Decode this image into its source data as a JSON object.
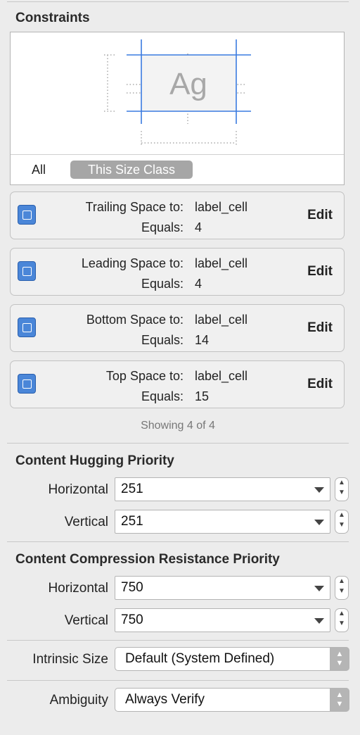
{
  "constraints": {
    "title": "Constraints",
    "preview_text": "Ag",
    "tabs": {
      "all": "All",
      "size_class": "This Size Class"
    },
    "rows": [
      {
        "label": "Trailing Space to:",
        "target": "label_cell",
        "equals_label": "Equals:",
        "value": "4",
        "edit": "Edit",
        "icon": "trailing-space-icon"
      },
      {
        "label": "Leading Space to:",
        "target": "label_cell",
        "equals_label": "Equals:",
        "value": "4",
        "edit": "Edit",
        "icon": "leading-space-icon"
      },
      {
        "label": "Bottom Space to:",
        "target": "label_cell",
        "equals_label": "Equals:",
        "value": "14",
        "edit": "Edit",
        "icon": "bottom-space-icon"
      },
      {
        "label": "Top Space to:",
        "target": "label_cell",
        "equals_label": "Equals:",
        "value": "15",
        "edit": "Edit",
        "icon": "top-space-icon"
      }
    ],
    "showing": "Showing 4 of 4"
  },
  "hugging": {
    "title": "Content Hugging Priority",
    "horizontal_label": "Horizontal",
    "horizontal_value": "251",
    "vertical_label": "Vertical",
    "vertical_value": "251"
  },
  "compression": {
    "title": "Content Compression Resistance Priority",
    "horizontal_label": "Horizontal",
    "horizontal_value": "750",
    "vertical_label": "Vertical",
    "vertical_value": "750"
  },
  "intrinsic": {
    "label": "Intrinsic Size",
    "value": "Default (System Defined)"
  },
  "ambiguity": {
    "label": "Ambiguity",
    "value": "Always Verify"
  },
  "colors": {
    "accent": "#3a7be0",
    "icon_blue": "#4a86d8",
    "panel_bg": "#ececec"
  }
}
